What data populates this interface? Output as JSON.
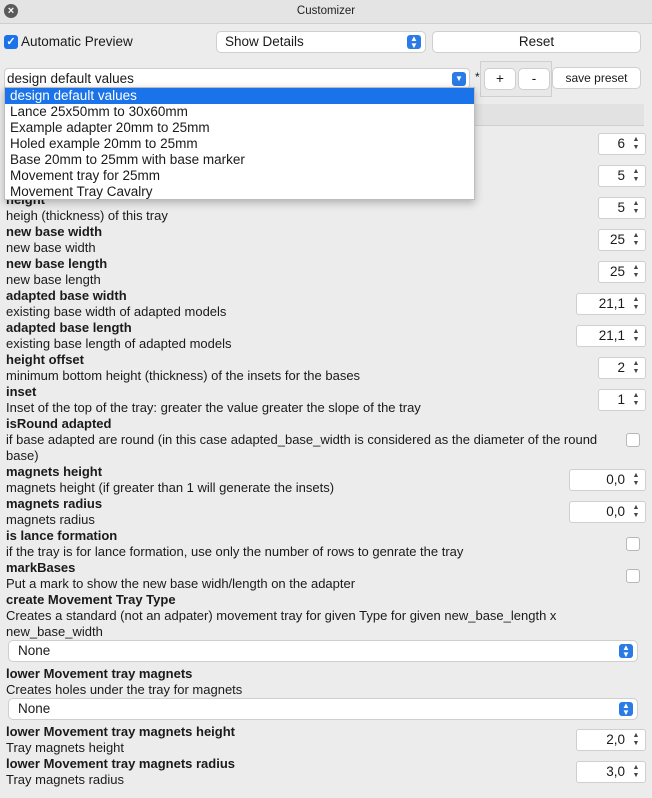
{
  "window": {
    "title": "Customizer"
  },
  "toolbar": {
    "auto_preview_label": "Automatic Preview",
    "auto_preview_checked": true,
    "details_select": "Show Details",
    "reset_label": "Reset"
  },
  "preset": {
    "current": "design default values",
    "dirty_marker": "*",
    "add_label": "+",
    "remove_label": "-",
    "save_label": "save preset",
    "options": [
      "design default values",
      "Lance 25x50mm to 30x60mm",
      "Example adapter 20mm to 25mm",
      "Holed example 20mm to 25mm",
      "Base 20mm to 25mm with base marker",
      "Movement tray for 25mm",
      "Movement Tray Cavalry"
    ]
  },
  "params": {
    "p0": {
      "value": "6"
    },
    "p1": {
      "value": "5"
    },
    "height": {
      "name": "height",
      "desc": "heigh (thickness) of this tray",
      "value": "5"
    },
    "new_base_width": {
      "name": "new base width",
      "desc": "new base width",
      "value": "25"
    },
    "new_base_length": {
      "name": "new base length",
      "desc": "new base length",
      "value": "25"
    },
    "adapted_base_width": {
      "name": "adapted base width",
      "desc": "existing base width of adapted models",
      "value": "21,1"
    },
    "adapted_base_length": {
      "name": "adapted base length",
      "desc": "existing base length of adapted models",
      "value": "21,1"
    },
    "height_offset": {
      "name": "height offset",
      "desc": "minimum bottom height (thickness) of the insets for the bases",
      "value": "2"
    },
    "inset": {
      "name": "inset",
      "desc": "Inset of the top of the tray: greater the value greater the slope of the tray",
      "value": "1"
    },
    "is_round": {
      "name": "isRound adapted",
      "desc": "if base adapted are round (in this case adapted_base_width is considered as the diameter of the round base)"
    },
    "magnets_height": {
      "name": "magnets height",
      "desc": "magnets height (if greater than 1 will generate the insets)",
      "value": "0,0"
    },
    "magnets_radius": {
      "name": "magnets radius",
      "desc": "magnets radius",
      "value": "0,0"
    },
    "lance": {
      "name": "is lance formation",
      "desc": "if the tray is for lance formation, use only the number of rows to genrate the tray"
    },
    "mark_bases": {
      "name": "markBases",
      "desc": "Put a mark to show the new base widh/length on the adapter"
    },
    "tray_type": {
      "name": "create Movement Tray Type",
      "desc": "Creates a standard (not an adpater) movement tray for given Type for given new_base_length x new_base_width",
      "value": "None"
    },
    "lower_magnets": {
      "name": "lower Movement tray magnets",
      "desc": "Creates holes under the tray for magnets",
      "value": "None"
    },
    "lower_magnets_height": {
      "name": "lower Movement tray magnets height",
      "desc": "Tray magnets height",
      "value": "2,0"
    },
    "lower_magnets_radius": {
      "name": "lower Movement tray magnets radius",
      "desc": "Tray magnets radius",
      "value": "3,0"
    }
  },
  "colors": {
    "accent": "#1a73e8"
  },
  "icons": {
    "close": "close-icon",
    "checkbox": "checkmark-icon",
    "select_arrow": "chevron-updown-icon",
    "spinner": "stepper-icon"
  }
}
